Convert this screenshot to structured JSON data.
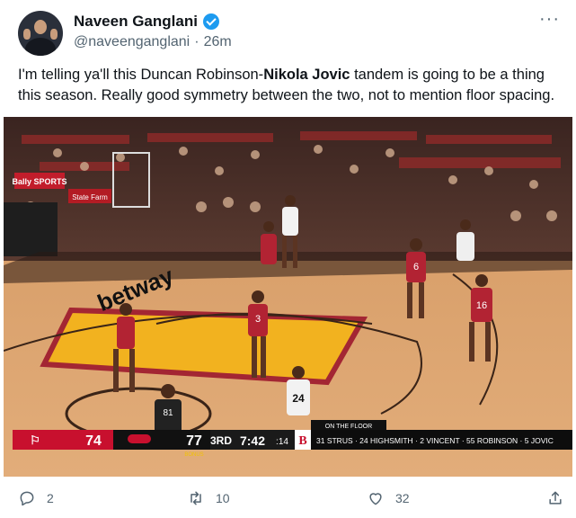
{
  "author": {
    "display_name": "Naveen Ganglani",
    "handle": "@naveenganglani",
    "separator": "·",
    "time": "26m",
    "verified_icon": "verified-badge-icon",
    "more_label": "···"
  },
  "tweet": {
    "text_before": "I'm telling ya'll this Duncan Robinson-",
    "text_bold": "Nikola Jovic",
    "text_after": " tandem is going to be a thing this season. Really good symmetry between the two, not to mention floor spacing."
  },
  "media": {
    "scoreboard": {
      "away_score": "74",
      "home_score": "77",
      "period": "3RD",
      "clock": "7:42",
      "shot_clock": ":14",
      "bonus": "BONUS",
      "on_the_floor": "ON THE FLOOR",
      "lineup": "31 STRUS · 24 HIGHSMITH · 2 VINCENT · 55 ROBINSON · 5 JOVIC"
    },
    "court_text": {
      "sponsor_left": "betway",
      "ad_bally": "Bally SPORTS",
      "ad_statefarm": "State Farm"
    },
    "jerseys": {
      "p1": "3",
      "p2": "6",
      "p3": "16",
      "p4": "24",
      "p5": "81"
    }
  },
  "actions": {
    "reply_count": "2",
    "retweet_count": "10",
    "like_count": "32",
    "colors": {
      "muted": "#536471",
      "accent": "#1d9bf0"
    }
  }
}
